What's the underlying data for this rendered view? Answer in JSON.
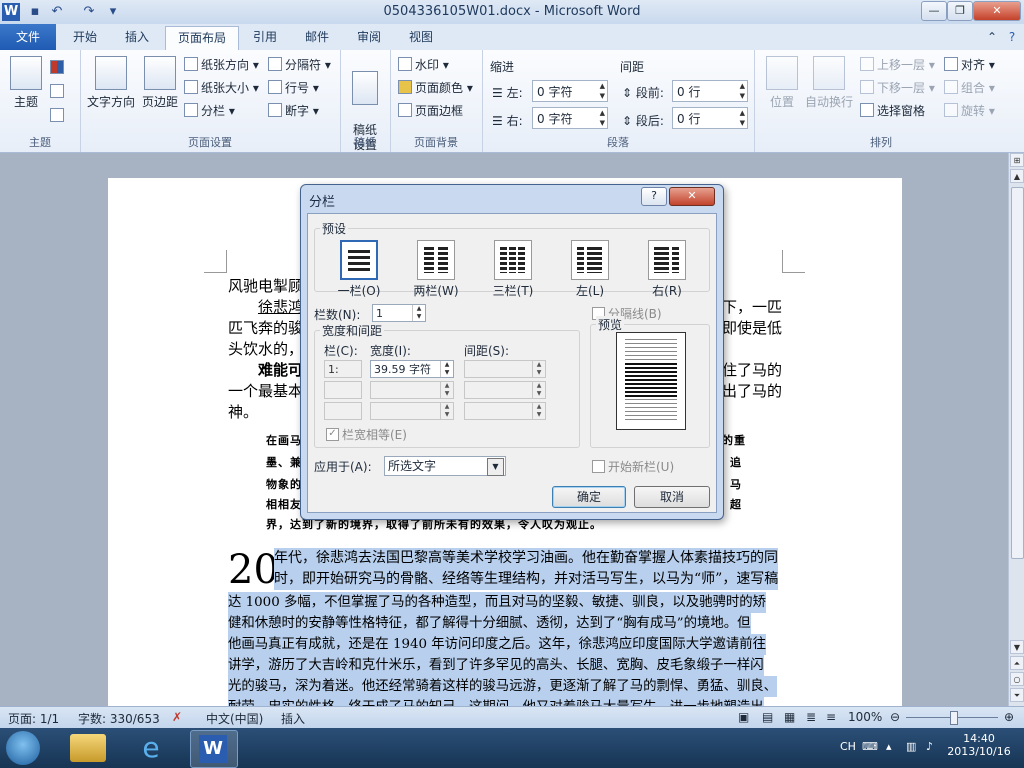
{
  "window": {
    "title": "0504336105W01.docx - Microsoft Word",
    "app_icon": "W",
    "quick_access": [
      "save-icon",
      "undo-icon",
      "redo-icon",
      "customize-icon"
    ]
  },
  "tabs": [
    {
      "label": "文件"
    },
    {
      "label": "开始"
    },
    {
      "label": "插入"
    },
    {
      "label": "页面布局"
    },
    {
      "label": "引用"
    },
    {
      "label": "邮件"
    },
    {
      "label": "审阅"
    },
    {
      "label": "视图"
    }
  ],
  "ribbon": {
    "theme_group": {
      "label": "主题",
      "button": "主题"
    },
    "page_setup": {
      "label": "页面设置",
      "text_direction": "文字方向",
      "margins": "页边距",
      "orientation": "纸张方向",
      "size": "纸张大小",
      "columns": "分栏",
      "breaks": "分隔符",
      "line_numbers": "行号",
      "hyphenation": "断字"
    },
    "manuscript": {
      "label": "稿纸",
      "button": "稿纸\n设置"
    },
    "page_background": {
      "label": "页面背景",
      "watermark": "水印",
      "page_color": "页面颜色",
      "page_borders": "页面边框"
    },
    "paragraph": {
      "label": "段落",
      "indent": "缩进",
      "spacing": "间距",
      "left": "左:",
      "right": "右:",
      "before": "段前:",
      "after": "段后:",
      "left_val": "0 字符",
      "right_val": "0 字符",
      "before_val": "0 行",
      "after_val": "0 行"
    },
    "arrange": {
      "label": "排列",
      "position": "位置",
      "wrap": "自动换行",
      "bring_forward": "上移一层",
      "send_backward": "下移一层",
      "selection_pane": "选择窗格",
      "align": "对齐",
      "group": "组合",
      "rotate": "旋转"
    }
  },
  "document": {
    "lines_top": [
      "风驰电掣顾",
      "徐悲鸿",
      "匹飞奔的骏",
      "头饮水的，",
      "难能可",
      "一个最基本",
      "神。"
    ],
    "lines_top_right": [
      "下，一匹",
      "即使是低",
      "住了马的",
      "出了马的"
    ],
    "quote_lines": [
      "在画马",
      "的重",
      "墨、兼",
      "追",
      "物象的",
      "马",
      "相相友",
      "超",
      "界，达到了新的境界，取得了前所未有的效果，令人叹为观止。"
    ],
    "dropcap": "20",
    "body_lines": [
      "年代，徐悲鸿去法国巴黎高等美术学校学习油画。他在勤奋掌握人体素描技巧的同",
      "时，即开始研究马的骨骼、经络等生理结构，并对活马写生，以马为“师”，速写稿",
      "达 1000 多幅，不但掌握了马的各种造型，而且对马的坚毅、敏捷、驯良，以及驰骋时的矫",
      "健和休憩时的安静等性格特征，都了解得十分细腻、透彻，达到了“胸有成马”的境地。但",
      "他画马真正有成就，还是在 1940 年访问印度之后。这年，徐悲鸿应印度国际大学邀请前往",
      "讲学，游历了大吉岭和克什米乐，看到了许多罕见的高头、长腿、宽胸、皮毛象缎子一样闪",
      "光的骏马，深为着迷。他还经常骑着这样的骏马远游，更逐渐了解了马的剽悍、勇猛、驯良、",
      "耐劳、忠实的性格，终于成了马的知己。这期间，他又对着骏马大量写生，进一步地塑造出"
    ]
  },
  "dialog": {
    "title": "分栏",
    "help": "?",
    "presets_label": "预设",
    "presets": [
      "一栏(O)",
      "两栏(W)",
      "三栏(T)",
      "左(L)",
      "右(R)"
    ],
    "num_columns_label": "栏数(N):",
    "num_columns_value": "1",
    "line_between_label": "分隔线(B)",
    "width_spacing_label": "宽度和间距",
    "col_header": "栏(C):",
    "width_header": "宽度(I):",
    "spacing_header": "间距(S):",
    "row1_col": "1:",
    "row1_width": "39.59 字符",
    "equal_width_label": "栏宽相等(E)",
    "preview_label": "预览",
    "apply_to_label": "应用于(A):",
    "apply_to_value": "所选文字",
    "start_new_column_label": "开始新栏(U)",
    "ok": "确定",
    "cancel": "取消"
  },
  "status": {
    "page": "页面: 1/1",
    "words": "字数: 330/653",
    "language": "中文(中国)",
    "mode": "插入",
    "zoom": "100%"
  },
  "taskbar": {
    "ime": "CH",
    "time": "14:40",
    "date": "2013/10/16"
  }
}
